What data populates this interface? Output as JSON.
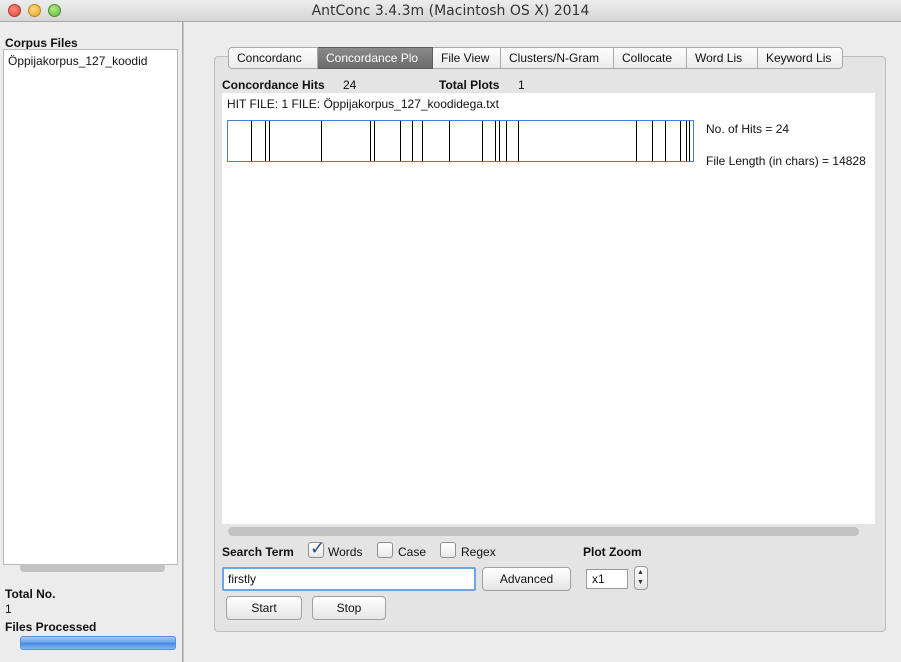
{
  "window": {
    "title": "AntConc 3.4.3m (Macintosh OS X) 2014"
  },
  "sidebar": {
    "corpus_files_label": "Corpus Files",
    "files": [
      "Öppijakorpus_127_koodid"
    ],
    "total_no_label": "Total No.",
    "total_no_value": "1",
    "files_processed_label": "Files Processed",
    "files_processed_progress": 1.0
  },
  "tabs": [
    {
      "label": "Concordanc",
      "active": false
    },
    {
      "label": "Concordance Plo",
      "active": true
    },
    {
      "label": "File View",
      "active": false
    },
    {
      "label": "Clusters/N-Gram",
      "active": false
    },
    {
      "label": "Collocate",
      "active": false
    },
    {
      "label": "Word Lis",
      "active": false
    },
    {
      "label": "Keyword Lis",
      "active": false
    }
  ],
  "summary": {
    "concordance_hits_label": "Concordance Hits",
    "concordance_hits_value": "24",
    "total_plots_label": "Total Plots",
    "total_plots_value": "1"
  },
  "plot": {
    "hit_file_text": "HIT FILE: 1   FILE: Öppijakorpus_127_koodidega.txt",
    "num_hits_text": "No. of Hits = 24",
    "file_length_text": "File Length (in chars) = 14828",
    "hit_positions": [
      0.049,
      0.08,
      0.089,
      0.2,
      0.306,
      0.315,
      0.37,
      0.395,
      0.418,
      0.475,
      0.547,
      0.575,
      0.583,
      0.598,
      0.624,
      0.878,
      0.912,
      0.94,
      0.973,
      0.985,
      0.992
    ],
    "line_color": "#000000",
    "frame_color": "#4a7fd0"
  },
  "search": {
    "search_term_label": "Search Term",
    "words_label": "Words",
    "words_checked": true,
    "case_label": "Case",
    "case_checked": false,
    "regex_label": "Regex",
    "regex_checked": false,
    "input_value": "firstly",
    "advanced_label": "Advanced",
    "start_label": "Start",
    "stop_label": "Stop",
    "plot_zoom_label": "Plot Zoom",
    "plot_zoom_value": "x1"
  }
}
